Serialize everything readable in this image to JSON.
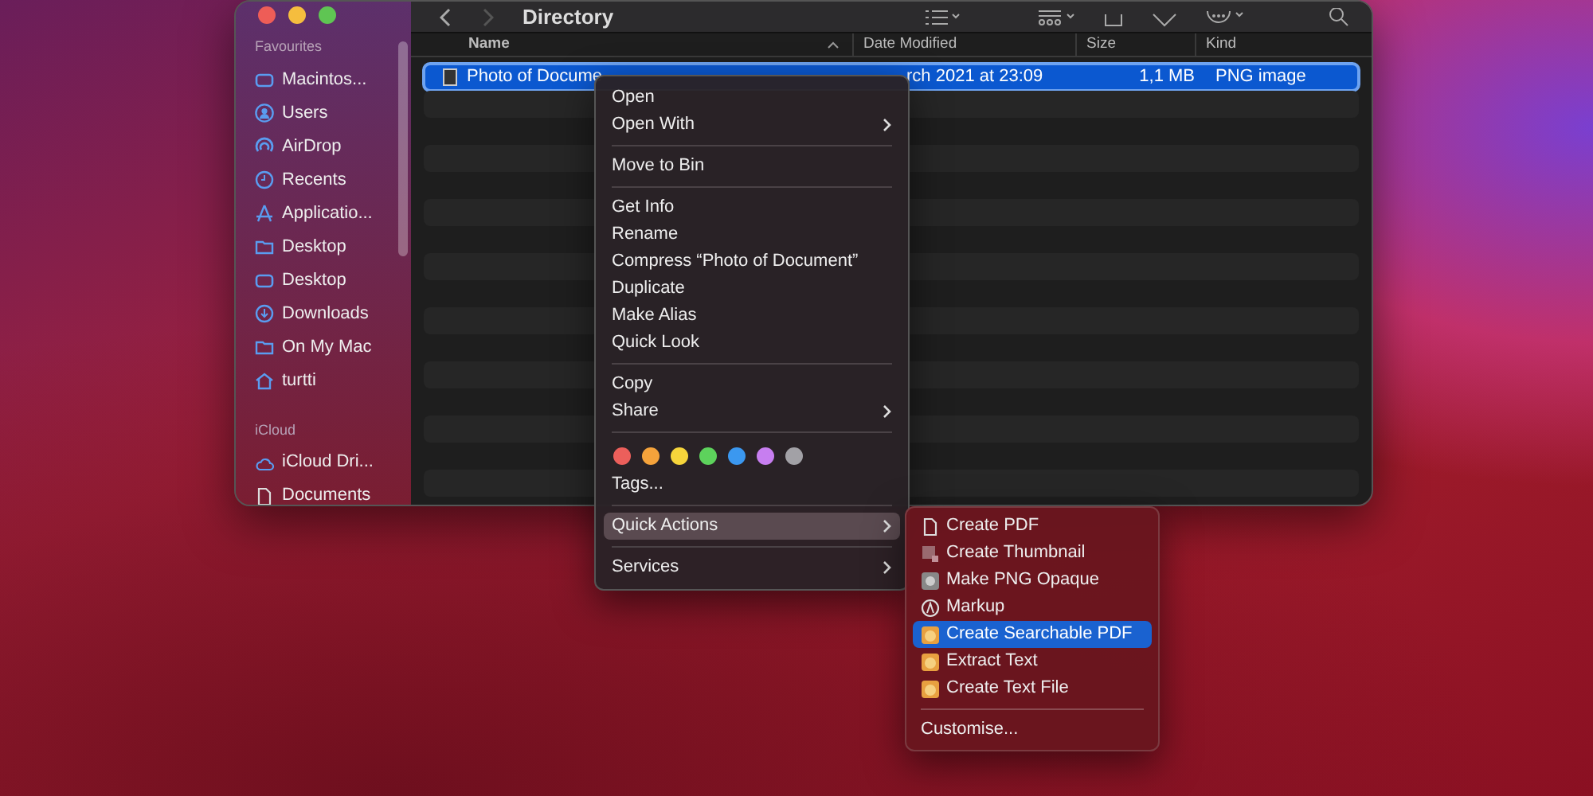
{
  "window": {
    "title": "Directory"
  },
  "sidebar": {
    "sections": [
      {
        "label": "Favourites",
        "items": [
          {
            "label": "Macintos..."
          },
          {
            "label": "Users"
          },
          {
            "label": "AirDrop"
          },
          {
            "label": "Recents"
          },
          {
            "label": "Applicatio..."
          },
          {
            "label": "Desktop"
          },
          {
            "label": "Desktop"
          },
          {
            "label": "Downloads"
          },
          {
            "label": "On My Mac"
          },
          {
            "label": "turtti"
          }
        ]
      },
      {
        "label": "iCloud",
        "items": [
          {
            "label": "iCloud Dri..."
          },
          {
            "label": "Documents"
          }
        ]
      }
    ]
  },
  "table": {
    "columns": [
      "Name",
      "Date Modified",
      "Size",
      "Kind"
    ],
    "rows": [
      {
        "selected": true,
        "cells": [
          "Photo of Docume",
          "rch 2021 at 23:09",
          "1,1 MB",
          "PNG image"
        ]
      }
    ]
  },
  "context_menu": {
    "items": [
      {
        "kind": "item",
        "label": "Open",
        "submenu": false,
        "selected": false
      },
      {
        "kind": "item",
        "label": "Open With",
        "submenu": true,
        "selected": false
      },
      {
        "kind": "separator"
      },
      {
        "kind": "item",
        "label": "Move to Bin",
        "submenu": false,
        "selected": false
      },
      {
        "kind": "separator"
      },
      {
        "kind": "item",
        "label": "Get Info",
        "submenu": false,
        "selected": false
      },
      {
        "kind": "item",
        "label": "Rename",
        "submenu": false,
        "selected": false
      },
      {
        "kind": "item",
        "label": "Compress “Photo of Document”",
        "submenu": false,
        "selected": false
      },
      {
        "kind": "item",
        "label": "Duplicate",
        "submenu": false,
        "selected": false
      },
      {
        "kind": "item",
        "label": "Make Alias",
        "submenu": false,
        "selected": false
      },
      {
        "kind": "item",
        "label": "Quick Look",
        "submenu": false,
        "selected": false
      },
      {
        "kind": "separator"
      },
      {
        "kind": "item",
        "label": "Copy",
        "submenu": false,
        "selected": false
      },
      {
        "kind": "item",
        "label": "Share",
        "submenu": true,
        "selected": false
      },
      {
        "kind": "separator"
      },
      {
        "kind": "tags",
        "tags": [
          {
            "color": "#ec5f5b"
          },
          {
            "color": "#f5a33b"
          },
          {
            "color": "#f6d53b"
          },
          {
            "color": "#5dd25c"
          },
          {
            "color": "#3b98f0"
          },
          {
            "color": "#c77ef0"
          },
          {
            "color": "#a2a1a6"
          }
        ]
      },
      {
        "kind": "item",
        "label": "Tags...",
        "submenu": false,
        "selected": false
      },
      {
        "kind": "separator"
      },
      {
        "kind": "item",
        "label": "Quick Actions",
        "submenu": true,
        "selected": true
      },
      {
        "kind": "separator"
      },
      {
        "kind": "item",
        "label": "Services",
        "submenu": true,
        "selected": false
      }
    ]
  },
  "submenu": {
    "items": [
      {
        "kind": "item",
        "label": "Create PDF",
        "selected": false
      },
      {
        "kind": "item",
        "label": "Create Thumbnail",
        "selected": false
      },
      {
        "kind": "item",
        "label": "Make PNG Opaque",
        "selected": false
      },
      {
        "kind": "item",
        "label": "Markup",
        "selected": false
      },
      {
        "kind": "item",
        "label": "Create Searchable PDF",
        "selected": true
      },
      {
        "kind": "item",
        "label": "Extract Text",
        "selected": false
      },
      {
        "kind": "item",
        "label": "Create Text File",
        "selected": false
      },
      {
        "kind": "separator"
      },
      {
        "kind": "item",
        "label": "Customise...",
        "selected": false
      }
    ]
  }
}
